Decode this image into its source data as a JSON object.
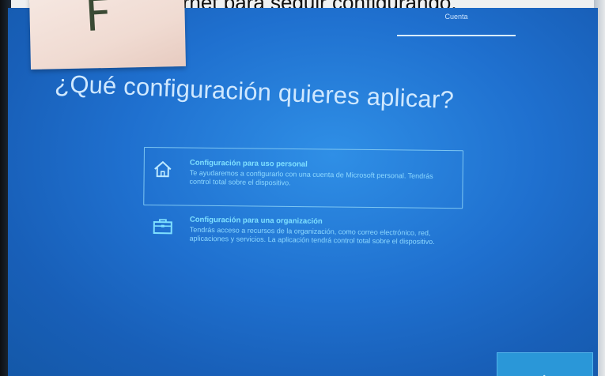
{
  "photo_caption": "Internet para seguir configurando.",
  "note": {
    "letter": "F"
  },
  "nav": {
    "tab_label": "Cuenta"
  },
  "main": {
    "heading": "¿Qué configuración quieres aplicar?",
    "options": [
      {
        "icon": "home-icon",
        "title": "Configuración para uso personal",
        "description": "Te ayudaremos a configurarlo con una cuenta de Microsoft personal. Tendrás control total sobre el dispositivo."
      },
      {
        "icon": "briefcase-icon",
        "title": "Configuración para una organización",
        "description": "Tendrás acceso a recursos de la organización, como correo electrónico, red, aplicaciones y servicios. La aplicación tendrá control total sobre el dispositivo."
      }
    ],
    "selected_option": "Configuración para uso personal"
  },
  "colors": {
    "screen_background": "#1f70cf",
    "option_title": "#7fe0ff",
    "option_text": "#8ed9ff",
    "selection_border": "#7dc6f2",
    "next_button": "#2a97d8"
  }
}
